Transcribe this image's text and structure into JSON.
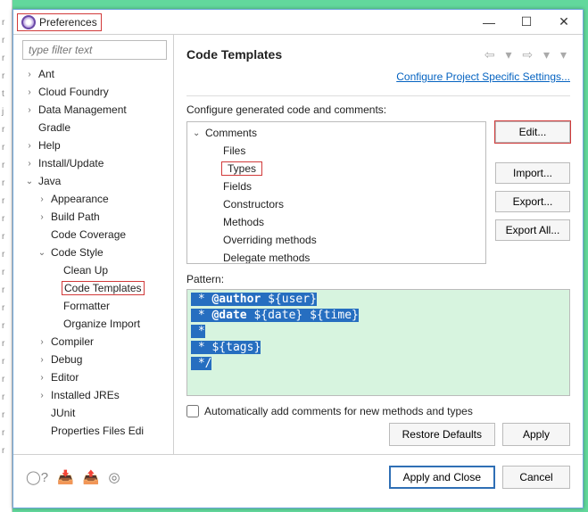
{
  "window": {
    "title": "Preferences",
    "minimize": "—",
    "maximize": "☐",
    "close": "✕"
  },
  "filter_placeholder": "type filter text",
  "tree": [
    {
      "label": "Ant",
      "lvl": 0,
      "tw": "›"
    },
    {
      "label": "Cloud Foundry",
      "lvl": 0,
      "tw": "›"
    },
    {
      "label": "Data Management",
      "lvl": 0,
      "tw": "›"
    },
    {
      "label": "Gradle",
      "lvl": 0,
      "tw": ""
    },
    {
      "label": "Help",
      "lvl": 0,
      "tw": "›"
    },
    {
      "label": "Install/Update",
      "lvl": 0,
      "tw": "›"
    },
    {
      "label": "Java",
      "lvl": 0,
      "tw": "⌄"
    },
    {
      "label": "Appearance",
      "lvl": 1,
      "tw": "›"
    },
    {
      "label": "Build Path",
      "lvl": 1,
      "tw": "›"
    },
    {
      "label": "Code Coverage",
      "lvl": 1,
      "tw": ""
    },
    {
      "label": "Code Style",
      "lvl": 1,
      "tw": "⌄"
    },
    {
      "label": "Clean Up",
      "lvl": 2,
      "tw": ""
    },
    {
      "label": "Code Templates",
      "lvl": 2,
      "tw": "",
      "selected": true
    },
    {
      "label": "Formatter",
      "lvl": 2,
      "tw": ""
    },
    {
      "label": "Organize Import",
      "lvl": 2,
      "tw": ""
    },
    {
      "label": "Compiler",
      "lvl": 1,
      "tw": "›"
    },
    {
      "label": "Debug",
      "lvl": 1,
      "tw": "›"
    },
    {
      "label": "Editor",
      "lvl": 1,
      "tw": "›"
    },
    {
      "label": "Installed JREs",
      "lvl": 1,
      "tw": "›"
    },
    {
      "label": "JUnit",
      "lvl": 1,
      "tw": ""
    },
    {
      "label": "Properties Files Edi",
      "lvl": 1,
      "tw": ""
    }
  ],
  "page": {
    "title": "Code Templates",
    "config_link": "Configure Project Specific Settings...",
    "section_label": "Configure generated code and comments:",
    "tree": [
      {
        "label": "Comments",
        "lvl": 0,
        "tw": "⌄"
      },
      {
        "label": "Files",
        "lvl": 1
      },
      {
        "label": "Types",
        "lvl": 1,
        "hl": true
      },
      {
        "label": "Fields",
        "lvl": 1
      },
      {
        "label": "Constructors",
        "lvl": 1
      },
      {
        "label": "Methods",
        "lvl": 1
      },
      {
        "label": "Overriding methods",
        "lvl": 1
      },
      {
        "label": "Delegate methods",
        "lvl": 1
      }
    ],
    "buttons": {
      "edit": "Edit...",
      "import": "Import...",
      "export": "Export...",
      "export_all": "Export All..."
    },
    "pattern_label": "Pattern:",
    "pattern_lines": [
      " * @author ${user}",
      " * @date ${date} ${time}",
      " * ",
      " * ${tags}",
      " */"
    ],
    "auto_checkbox": "Automatically add comments for new methods and types",
    "restore": "Restore Defaults",
    "apply": "Apply"
  },
  "bottom": {
    "apply_close": "Apply and Close",
    "cancel": "Cancel"
  },
  "nav_arrows": "⇦ ▾ ⇨ ▾ ▾"
}
